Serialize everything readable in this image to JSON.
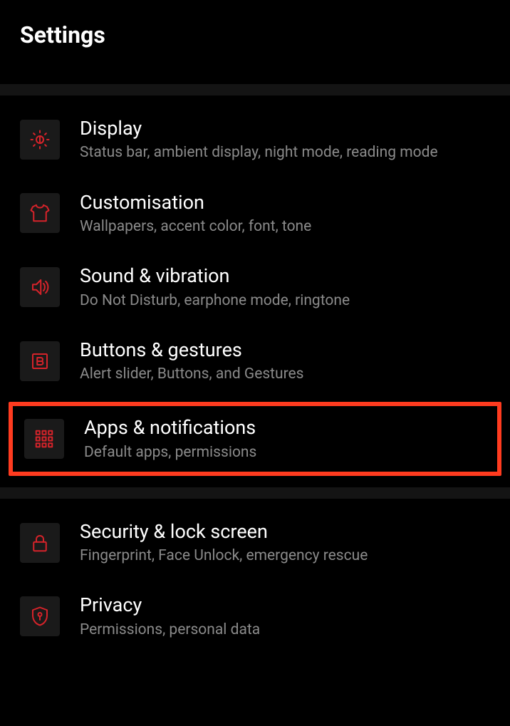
{
  "header": {
    "title": "Settings"
  },
  "sections": [
    {
      "items": [
        {
          "id": "display",
          "title": "Display",
          "subtitle": "Status bar, ambient display, night mode, reading mode",
          "highlighted": false
        },
        {
          "id": "customisation",
          "title": "Customisation",
          "subtitle": "Wallpapers, accent color, font, tone",
          "highlighted": false
        },
        {
          "id": "sound",
          "title": "Sound & vibration",
          "subtitle": "Do Not Disturb, earphone mode, ringtone",
          "highlighted": false
        },
        {
          "id": "buttons",
          "title": "Buttons & gestures",
          "subtitle": "Alert slider, Buttons, and Gestures",
          "highlighted": false
        },
        {
          "id": "apps",
          "title": "Apps & notifications",
          "subtitle": "Default apps, permissions",
          "highlighted": true
        }
      ]
    },
    {
      "items": [
        {
          "id": "security",
          "title": "Security & lock screen",
          "subtitle": "Fingerprint, Face Unlock, emergency rescue",
          "highlighted": false
        },
        {
          "id": "privacy",
          "title": "Privacy",
          "subtitle": "Permissions, personal data",
          "highlighted": false
        }
      ]
    }
  ],
  "icons": {
    "display": "brightness-icon",
    "customisation": "shirt-icon",
    "sound": "speaker-icon",
    "buttons": "button-b-icon",
    "apps": "grid-icon",
    "security": "lock-icon",
    "privacy": "shield-key-icon"
  }
}
